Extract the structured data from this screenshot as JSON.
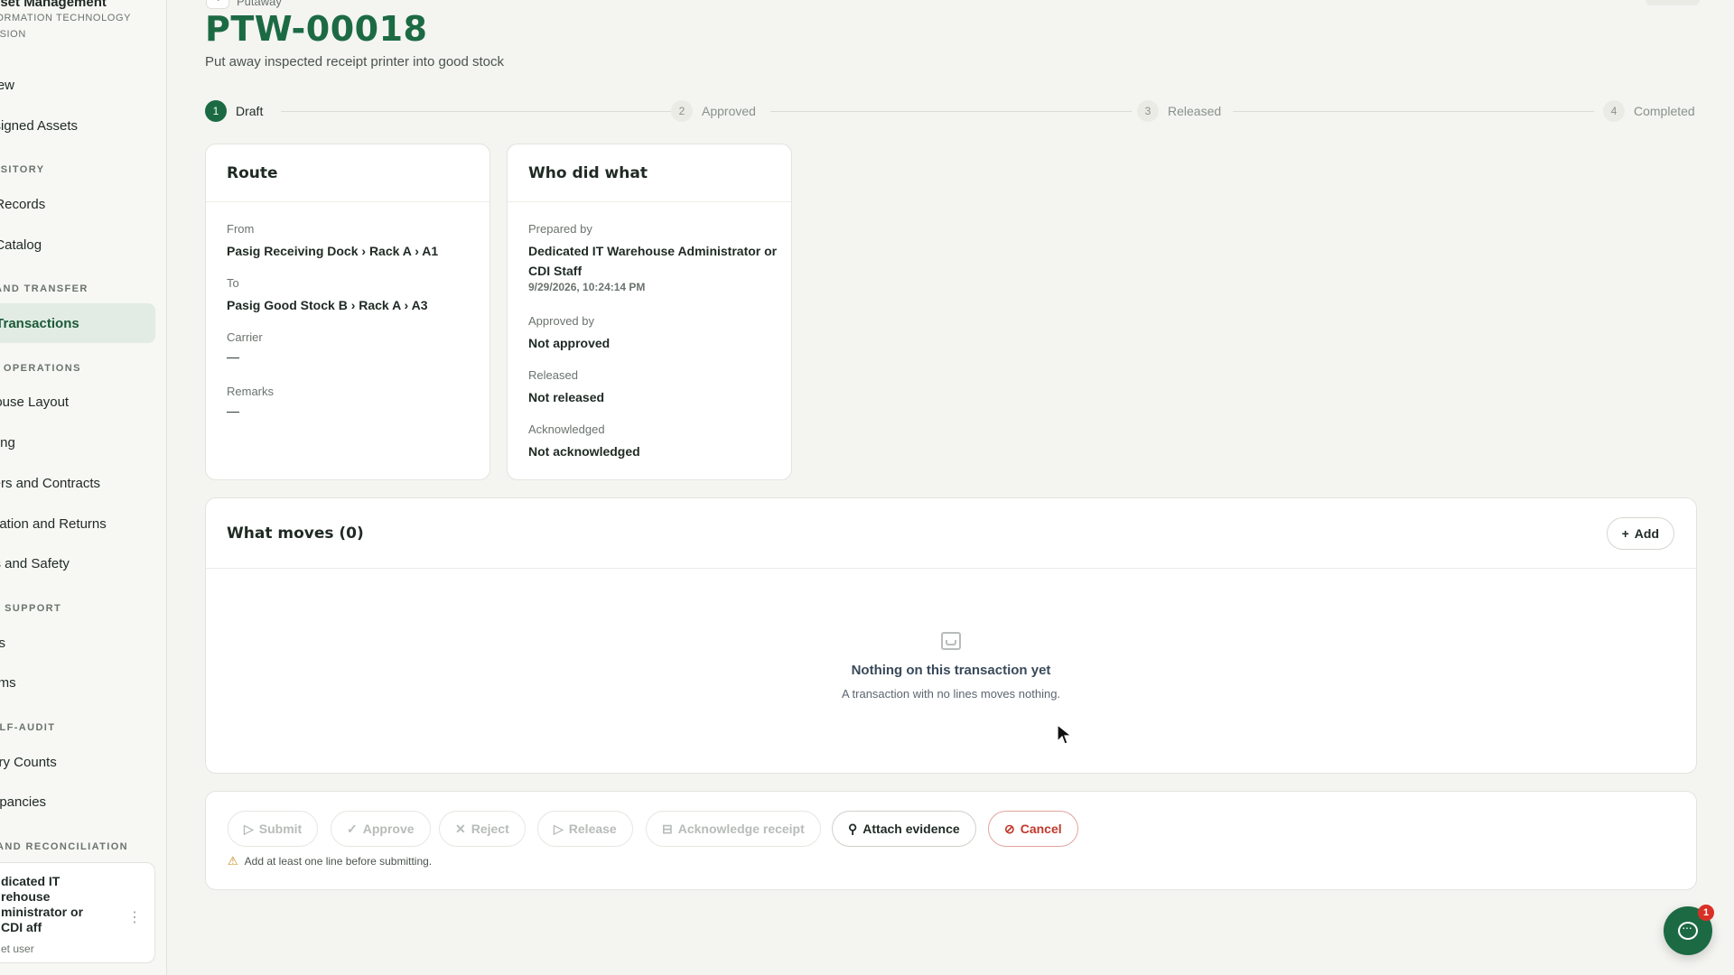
{
  "sidebar": {
    "brand_title": "sset Management",
    "brand_subtitle": "FORMATION TECHNOLOGY VISION",
    "items": [
      {
        "label": "view"
      },
      {
        "label": "ssigned Assets"
      },
      {
        "label": "t Records"
      },
      {
        "label": "t Catalog"
      },
      {
        "label": "t Transactions",
        "active": true
      },
      {
        "label": "house Layout"
      },
      {
        "label": "iving"
      },
      {
        "label": "liers and Contracts"
      },
      {
        "label": "aration and Returns"
      },
      {
        "label": "ss and Safety"
      },
      {
        "label": "ets"
      },
      {
        "label": "lems"
      },
      {
        "label": "tory Counts"
      },
      {
        "label": "repancies"
      }
    ],
    "sections": [
      "POSITORY",
      "T AND TRANSFER",
      "SE OPERATIONS",
      "ND SUPPORT",
      "SELF-AUDIT",
      "G AND RECONCILIATION"
    ],
    "user": {
      "name": "dicated IT rehouse ministrator or CDI aff",
      "role": "et user"
    }
  },
  "header": {
    "breadcrumb": "Putaway",
    "title": "PTW-00018",
    "subtitle": "Put away inspected receipt printer into good stock"
  },
  "stepper": [
    {
      "num": "1",
      "label": "Draft",
      "state": "active"
    },
    {
      "num": "2",
      "label": "Approved",
      "state": "pending"
    },
    {
      "num": "3",
      "label": "Released",
      "state": "pending"
    },
    {
      "num": "4",
      "label": "Completed",
      "state": "pending"
    }
  ],
  "route": {
    "title": "Route",
    "from_label": "From",
    "from_value": "Pasig Receiving Dock › Rack A › A1",
    "to_label": "To",
    "to_value": "Pasig Good Stock B › Rack A › A3",
    "carrier_label": "Carrier",
    "carrier_value": "—",
    "remarks_label": "Remarks",
    "remarks_value": "—"
  },
  "who": {
    "title": "Who did what",
    "prepared_label": "Prepared by",
    "prepared_value": "Dedicated IT Warehouse Administrator or CDI Staff",
    "prepared_time": "9/29/2026, 10:24:14 PM",
    "approved_label": "Approved by",
    "approved_value": "Not approved",
    "released_label": "Released",
    "released_value": "Not released",
    "ack_label": "Acknowledged",
    "ack_value": "Not acknowledged"
  },
  "moves": {
    "title": "What moves (0)",
    "add_label": "Add",
    "empty_title": "Nothing on this transaction yet",
    "empty_sub": "A transaction with no lines moves nothing."
  },
  "actions": {
    "submit": "Submit",
    "approve": "Approve",
    "reject": "Reject",
    "release": "Release",
    "acknowledge": "Acknowledge receipt",
    "attach": "Attach evidence",
    "cancel": "Cancel",
    "warning": "Add at least one line before submitting."
  },
  "chat": {
    "badge": "1"
  },
  "colors": {
    "accent": "#1c6a43",
    "danger": "#c0392b",
    "warning": "#c48a13"
  }
}
